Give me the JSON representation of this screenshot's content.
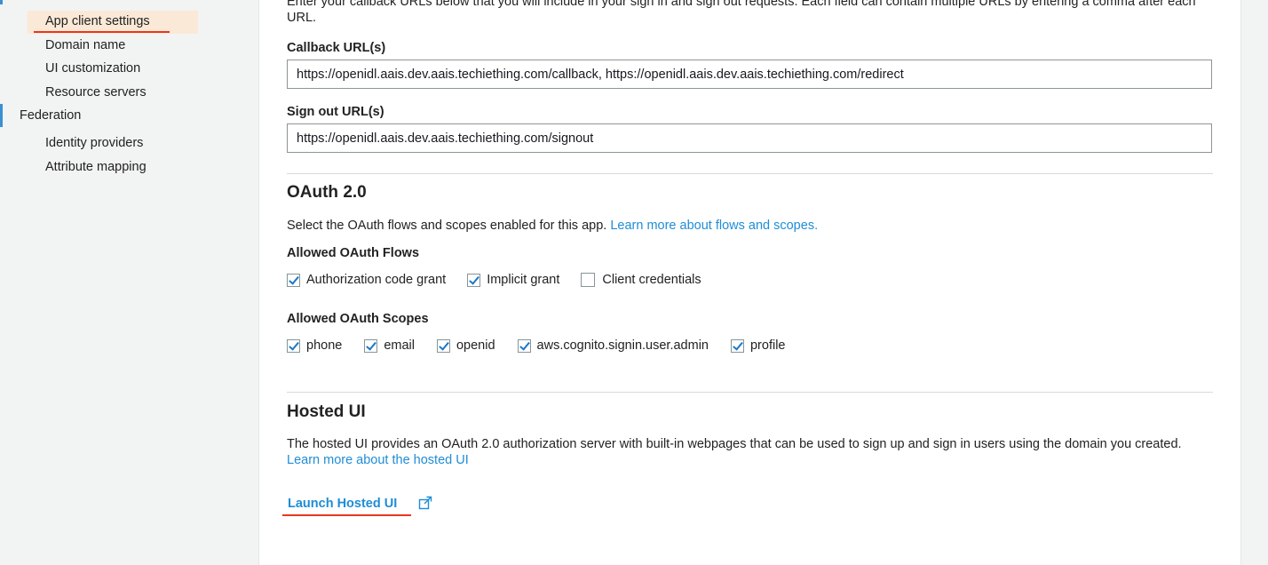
{
  "sidebar": {
    "items": [
      {
        "label": "App client settings",
        "active": true
      },
      {
        "label": "Domain name"
      },
      {
        "label": "UI customization"
      },
      {
        "label": "Resource servers"
      },
      {
        "label": "Federation"
      },
      {
        "label": "Identity providers"
      },
      {
        "label": "Attribute mapping"
      }
    ]
  },
  "callbacks": {
    "intro": "Enter your callback URLs below that you will include in your sign in and sign out requests. Each field can contain multiple URLs by entering a comma after each URL.",
    "callback_label": "Callback URL(s)",
    "callback_value": "https://openidl.aais.dev.aais.techiething.com/callback, https://openidl.aais.dev.aais.techiething.com/redirect",
    "signout_label": "Sign out URL(s)",
    "signout_value": "https://openidl.aais.dev.aais.techiething.com/signout"
  },
  "oauth": {
    "title": "OAuth 2.0",
    "description": "Select the OAuth flows and scopes enabled for this app.",
    "learn_link": "Learn more about flows and scopes.",
    "flows_label": "Allowed OAuth Flows",
    "flows": [
      {
        "label": "Authorization code grant",
        "checked": true
      },
      {
        "label": "Implicit grant",
        "checked": true
      },
      {
        "label": "Client credentials",
        "checked": false
      }
    ],
    "scopes_label": "Allowed OAuth Scopes",
    "scopes": [
      {
        "label": "phone",
        "checked": true
      },
      {
        "label": "email",
        "checked": true
      },
      {
        "label": "openid",
        "checked": true
      },
      {
        "label": "aws.cognito.signin.user.admin",
        "checked": true
      },
      {
        "label": "profile",
        "checked": true
      }
    ]
  },
  "hosted_ui": {
    "title": "Hosted UI",
    "description": "The hosted UI provides an OAuth 2.0 authorization server with built-in webpages that can be used to sign up and sign in users using the domain you created.",
    "learn_link": "Learn more about the hosted UI",
    "launch_label": "Launch Hosted UI"
  },
  "colors": {
    "accent": "#1f8dd6",
    "highlight_bg": "#fbe9d7",
    "annotation_red": "#e8361f",
    "checkbox_check": "#1b78c8"
  }
}
